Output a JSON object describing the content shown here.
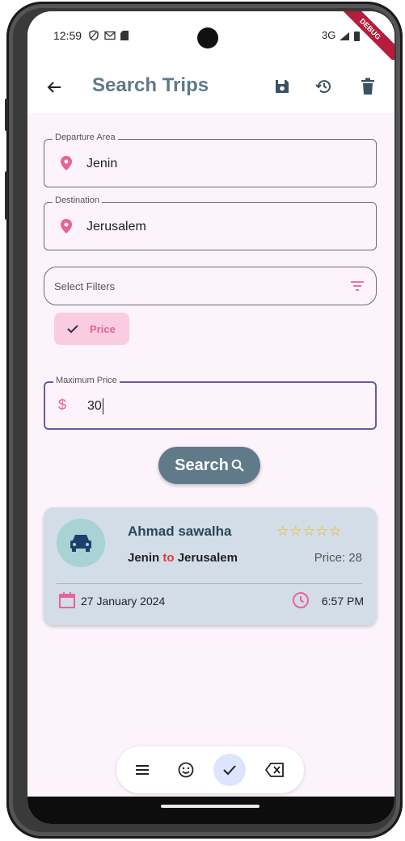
{
  "status_bar": {
    "time": "12:59",
    "left_icons": [
      "shield-icon",
      "mail-icon",
      "sd-card-icon"
    ],
    "network": "3G",
    "debug_banner": "DEBUG"
  },
  "app_bar": {
    "title": "Search Trips",
    "actions": [
      "save-icon",
      "history-icon",
      "delete-icon"
    ]
  },
  "form": {
    "departure": {
      "label": "Departure Area",
      "value": "Jenin"
    },
    "destination": {
      "label": "Destination",
      "value": "Jerusalem"
    },
    "filters": {
      "placeholder": "Select Filters"
    },
    "selected_chip": "Price",
    "max_price": {
      "label": "Maximum Price",
      "value": "30",
      "prefix": "$"
    },
    "search_label": "Search"
  },
  "trip": {
    "driver": "Ahmad sawalha",
    "rating_stars": 5,
    "stars_text": "☆☆☆☆☆",
    "from": "Jenin",
    "to_word": "to",
    "to": "Jerusalem",
    "price": "Price: 28",
    "date": "27 January 2024",
    "time": "6:57 PM"
  },
  "toolbar": {
    "buttons": [
      "menu-icon",
      "emoji-icon",
      "check-icon",
      "backspace-icon"
    ],
    "active": "check-icon"
  },
  "colors": {
    "accent": "#5f7a89",
    "pink": "#e8639a",
    "background": "#fcf3fb",
    "card": "#d3dde7"
  }
}
